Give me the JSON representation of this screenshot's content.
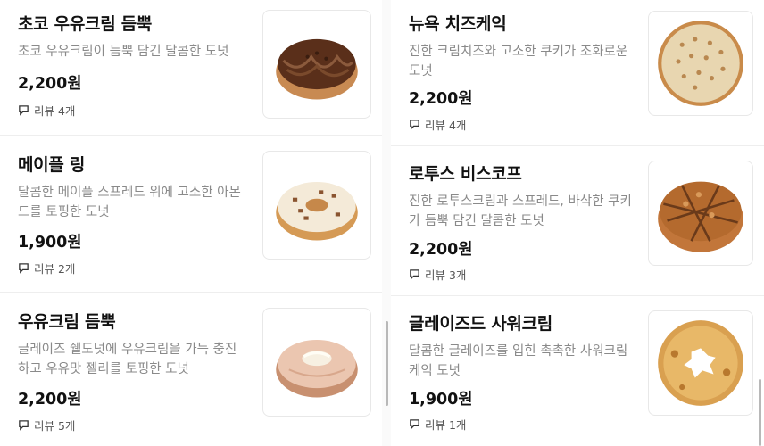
{
  "left_column": [
    {
      "name": "초코 우유크림 듬뿍",
      "desc": "초코 우유크림이 듬뿍 담긴 달콤한 도넛",
      "price": "2,200원",
      "reviews": "리뷰 4개"
    },
    {
      "name": "메이플 링",
      "desc": "달콤한 메이플 스프레드 위에 고소한 아몬드를 토핑한 도넛",
      "price": "1,900원",
      "reviews": "리뷰 2개"
    },
    {
      "name": "우유크림 듬뿍",
      "desc": "글레이즈 쉘도넛에 우유크림을 가득 충진하고 우유맛 젤리를 토핑한 도넛",
      "price": "2,200원",
      "reviews": "리뷰 5개"
    }
  ],
  "right_column": [
    {
      "name": "뉴욕 치즈케익",
      "desc": "진한 크림치즈와 고소한 쿠키가 조화로운 도넛",
      "price": "2,200원",
      "reviews": "리뷰 4개"
    },
    {
      "name": "로투스 비스코프",
      "desc": "진한 로투스크림과 스프레드, 바삭한 쿠키가 듬뿍 담긴 달콤한 도넛",
      "price": "2,200원",
      "reviews": "리뷰 3개"
    },
    {
      "name": "글레이즈드 사워크림",
      "desc": "달콤한 글레이즈를 입힌 촉촉한 사워크림 케익 도넛",
      "price": "1,900원",
      "reviews": "리뷰 1개"
    }
  ],
  "icons": {
    "review": "speech-bubble-icon"
  },
  "colors": {
    "price": "#111111",
    "desc": "#8a8a8a",
    "divider": "#eeeeee"
  }
}
